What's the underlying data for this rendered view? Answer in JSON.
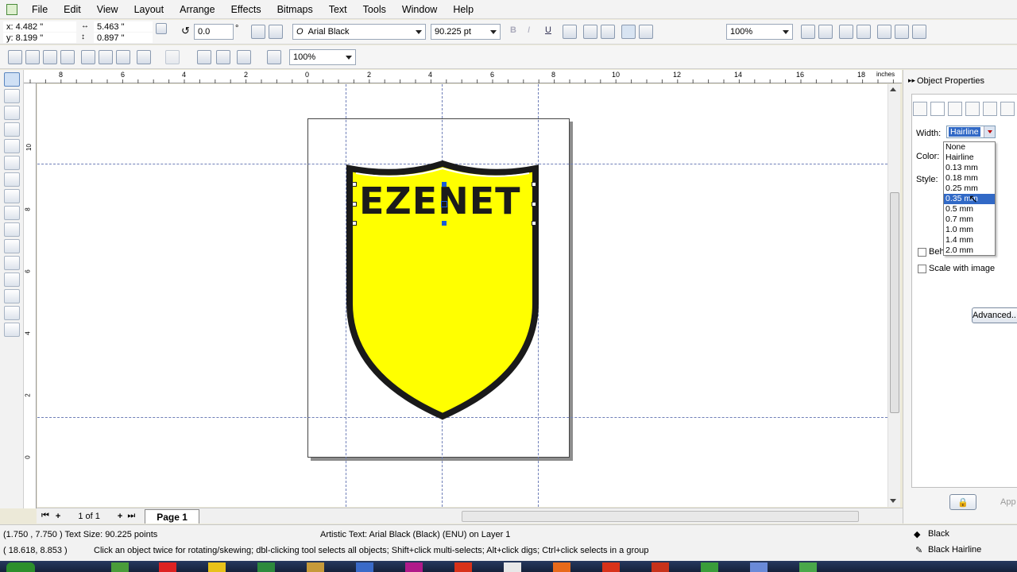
{
  "menu": [
    "File",
    "Edit",
    "View",
    "Layout",
    "Arrange",
    "Effects",
    "Bitmaps",
    "Text",
    "Tools",
    "Window",
    "Help"
  ],
  "propbar": {
    "x": "x: 4.482 \"",
    "y": "y: 8.199 \"",
    "w": "5.463 \"",
    "h": "0.897 \"",
    "angle": "0.0",
    "degree": "°",
    "font": "Arial Black",
    "font_size": "90.225 pt",
    "zoom": "100%"
  },
  "stdbar": {
    "zoom": "100%"
  },
  "ruler": {
    "h_labels": [
      "8",
      "6",
      "4",
      "2",
      "0",
      "2",
      "4",
      "6",
      "8",
      "10",
      "12",
      "14",
      "16",
      "18"
    ],
    "units": "inches",
    "v_labels": [
      "10",
      "8",
      "6",
      "4",
      "2",
      "0"
    ]
  },
  "artwork": {
    "logo_text": "EZENET",
    "fill": "#ffff00",
    "outline": "#1a1a1a"
  },
  "docker": {
    "title": "Object Properties",
    "width_label": "Width:",
    "width_value": "Hairline",
    "color_label": "Color:",
    "style_label": "Style:",
    "behind_fill": "Behi",
    "scale_with_image": "Scale with image",
    "advanced": "Advanced...",
    "apply": "App",
    "width_options": [
      "None",
      "Hairline",
      "0.13 mm",
      "0.18 mm",
      "0.25 mm",
      "0.35 mm",
      "0.5 mm",
      "0.7 mm",
      "1.0 mm",
      "1.4 mm",
      "2.0 mm"
    ],
    "selected_option": "0.35 mm"
  },
  "pagebar": {
    "counter": "1 of 1",
    "page_tab": "Page 1"
  },
  "status": {
    "line1_left": "(1.750 , 7.750 )  Text Size: 90.225 points",
    "line1_mid": "Artistic Text: Arial Black (Black) (ENU) on Layer 1",
    "line2_left": "( 18.618, 8.853 )",
    "line2_mid": "Click an object twice for rotating/skewing; dbl-clicking tool selects all objects; Shift+click multi-selects; Alt+click digs; Ctrl+click selects in a group",
    "fill": "Black",
    "outline": "Black  Hairline"
  }
}
